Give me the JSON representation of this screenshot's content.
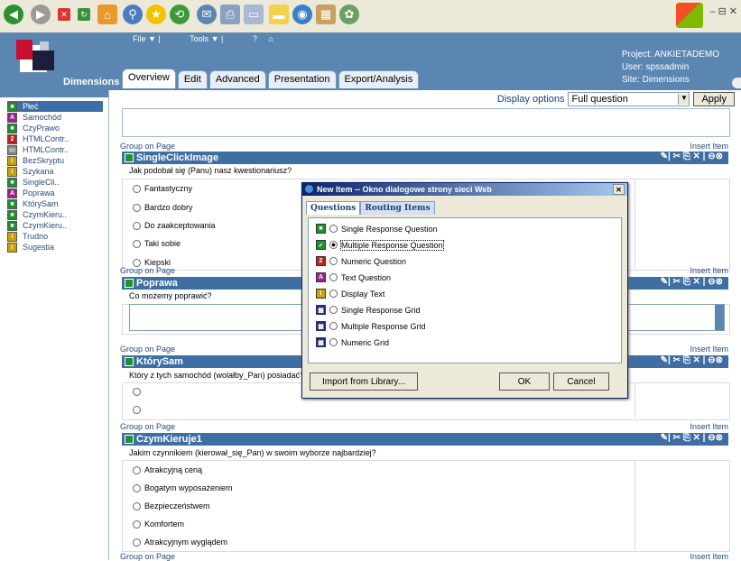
{
  "app": {
    "brand": "Dimensions"
  },
  "menu": {
    "file": "File ▼ |",
    "tools": "Tools ▼ |"
  },
  "project": {
    "project": "Project: ANKIETADEMO",
    "user": "User: spssadmin",
    "site": "Site: Dimensions"
  },
  "tabs": [
    "Overview",
    "Edit",
    "Advanced",
    "Presentation",
    "Export/Analysis"
  ],
  "tree": [
    {
      "label": "Płeć",
      "icon": "single",
      "color": "#1f8f2f"
    },
    {
      "label": "Samochód",
      "icon": "text",
      "color": "#a0208f"
    },
    {
      "label": "CzyPrawo",
      "icon": "single",
      "color": "#1f8f2f"
    },
    {
      "label": "HTMLContr..",
      "icon": "numeric",
      "color": "#c02020"
    },
    {
      "label": "HTMLContr..",
      "icon": "html",
      "color": "#888888"
    },
    {
      "label": "BezSkryptu",
      "icon": "display",
      "color": "#c9a400"
    },
    {
      "label": "Szykana",
      "icon": "display",
      "color": "#c9a400"
    },
    {
      "label": "SingleCli..",
      "icon": "single",
      "color": "#1f8f2f"
    },
    {
      "label": "Poprawa",
      "icon": "text",
      "color": "#a0208f"
    },
    {
      "label": "KtórySam",
      "icon": "single",
      "color": "#1f8f2f"
    },
    {
      "label": "CzymKieru..",
      "icon": "single",
      "color": "#1f8f2f"
    },
    {
      "label": "CzymKieru..",
      "icon": "single",
      "color": "#1f8f2f"
    },
    {
      "label": "Trudno",
      "icon": "display",
      "color": "#c9a400"
    },
    {
      "label": "Sugestia",
      "icon": "display",
      "color": "#c9a400"
    }
  ],
  "display_options": {
    "label": "Display options",
    "value": "Full question",
    "apply": "Apply"
  },
  "group_label": "Group on Page",
  "insert_label": "Insert Item",
  "questions": [
    {
      "name": "SingleClickImage",
      "text": "Jak podobał się (Panu) nasz kwestionariusz?",
      "options": [
        "Fantastyczny",
        "Bardzo dobry",
        "Do zaakceptowania",
        "Taki sobie",
        "Kiepski"
      ]
    },
    {
      "name": "Poprawa",
      "text": "Co możemy poprawić?",
      "options": []
    },
    {
      "name": "KtórySam",
      "text": "Który z tych samochód (wolałby_Pan) posiadać?",
      "options": [
        "",
        ""
      ]
    },
    {
      "name": "CzymKieruje1",
      "text": "Jakim czynnikiem (kierował_się_Pan) w swoim wyborze najbardziej?",
      "options": [
        "Atrakcyjną ceną",
        "Bogatym wyposażeniem",
        "Bezpieczeństwem",
        "Komfortem",
        "Atrakcyjnym wyglądem"
      ]
    }
  ],
  "dialog": {
    "title": "New Item -- Okno dialogowe strony sieci Web",
    "tabs": [
      "Questions",
      "Routing Items"
    ],
    "items": [
      {
        "label": "Single Response Question",
        "checked": false
      },
      {
        "label": "Multiple Response Question",
        "checked": true
      },
      {
        "label": "Numeric Question",
        "checked": false
      },
      {
        "label": "Text Question",
        "checked": false
      },
      {
        "label": "Display Text",
        "checked": false
      },
      {
        "label": "Single Response Grid",
        "checked": false
      },
      {
        "label": "Multiple Response Grid",
        "checked": false
      },
      {
        "label": "Numeric Grid",
        "checked": false
      }
    ],
    "import": "Import from Library...",
    "ok": "OK",
    "cancel": "Cancel"
  }
}
